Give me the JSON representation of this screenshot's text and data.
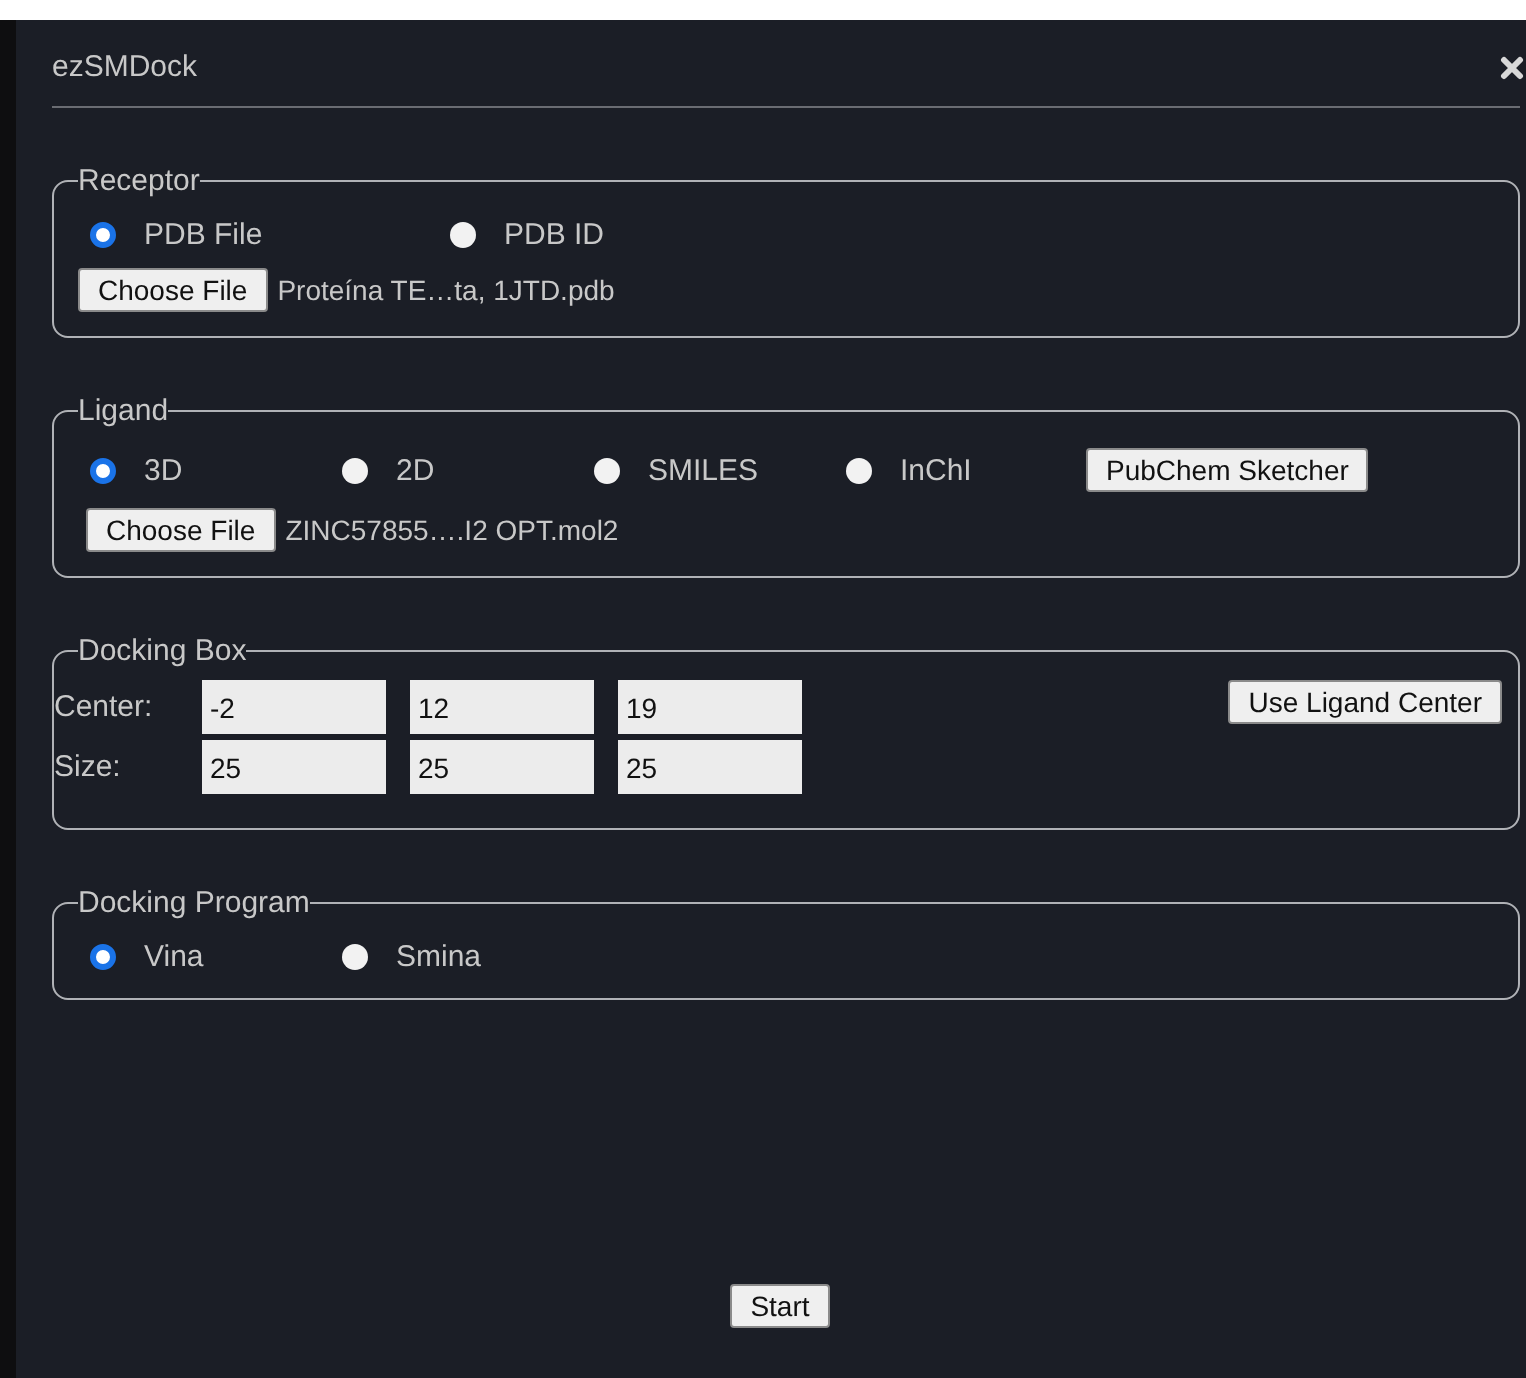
{
  "window": {
    "title": "ezSMDock"
  },
  "receptor": {
    "legend": "Receptor",
    "options": [
      {
        "label": "PDB File",
        "selected": true
      },
      {
        "label": "PDB ID",
        "selected": false
      }
    ],
    "file_button": "Choose File",
    "file_name": "Proteína TE…ta, 1JTD.pdb"
  },
  "ligand": {
    "legend": "Ligand",
    "options": [
      {
        "label": "3D",
        "selected": true
      },
      {
        "label": "2D",
        "selected": false
      },
      {
        "label": "SMILES",
        "selected": false
      },
      {
        "label": "InChI",
        "selected": false
      }
    ],
    "sketcher_button": "PubChem Sketcher",
    "file_button": "Choose File",
    "file_name": "ZINC57855….I2 OPT.mol2"
  },
  "docking_box": {
    "legend": "Docking Box",
    "rows": [
      {
        "label": "Center:",
        "values": [
          "-2",
          "12",
          "19"
        ]
      },
      {
        "label": "Size:",
        "values": [
          "25",
          "25",
          "25"
        ]
      }
    ],
    "center_button": "Use Ligand Center"
  },
  "docking_program": {
    "legend": "Docking Program",
    "options": [
      {
        "label": "Vina",
        "selected": true
      },
      {
        "label": "Smina",
        "selected": false
      }
    ]
  },
  "start_button": "Start"
}
